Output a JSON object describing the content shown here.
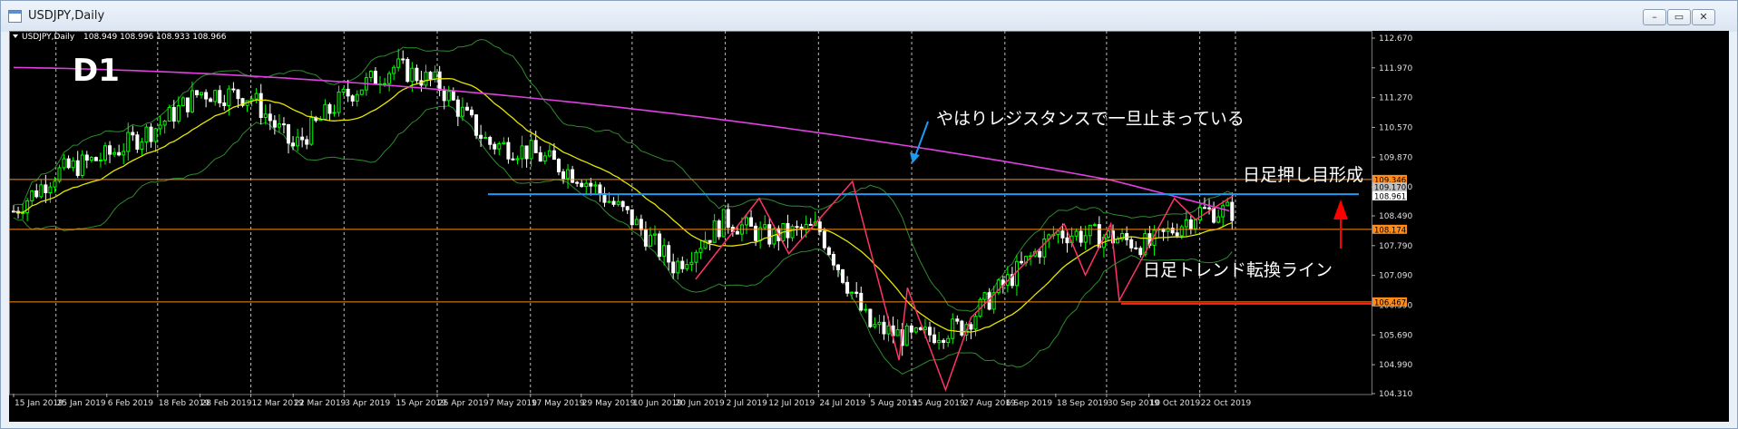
{
  "window": {
    "title": "USDJPY,Daily",
    "buttons": {
      "minimize": "–",
      "restore": "▭",
      "close": "✕"
    }
  },
  "chart_header": {
    "symbol_label": "USDJPY,Daily",
    "ohlc": "108.949 108.996 108.933 108.966"
  },
  "annotations": {
    "timeframe_label": "D1",
    "resistance_note": "やはりレジスタンスで一旦止まっている",
    "pullback_note": "日足押し目形成",
    "trend_line_note": "日足トレンド転換ライン"
  },
  "price_axis_ticks": [
    "112.670",
    "111.970",
    "111.270",
    "110.570",
    "109.870",
    "109.170",
    "108.490",
    "107.790",
    "107.090",
    "106.390",
    "105.690",
    "104.990",
    "104.310"
  ],
  "level_tags": [
    {
      "label": "109.346",
      "color": "#ff8c1a"
    },
    {
      "label": "109.170",
      "color": "#c0c0c0"
    },
    {
      "label": "108.961",
      "color": "#ffffff"
    },
    {
      "label": "108.174",
      "color": "#ff8c1a"
    },
    {
      "label": "106.467",
      "color": "#ff8c1a"
    }
  ],
  "date_ticks": [
    "15 Jan 2019",
    "25 Jan 2019",
    "6 Feb 2019",
    "18 Feb 2019",
    "28 Feb 2019",
    "12 Mar 2019",
    "22 Mar 2019",
    "3 Apr 2019",
    "15 Apr 2019",
    "25 Apr 2019",
    "7 May 2019",
    "17 May 2019",
    "29 May 2019",
    "10 Jun 2019",
    "20 Jun 2019",
    "2 Jul 2019",
    "12 Jul 2019",
    "24 Jul 2019",
    "5 Aug 2019",
    "15 Aug 2019",
    "27 Aug 2019",
    "6 Sep 2019",
    "18 Sep 2019",
    "30 Sep 2019",
    "10 Oct 2019",
    "22 Oct 2019"
  ],
  "colors": {
    "background": "#000000",
    "bull_candle": "#00ff00",
    "bear_candle": "#ffffff",
    "ma_long": "#e040e0",
    "ma_short": "#e6e600",
    "bollinger": "#2e8b2e",
    "horizontal_level": "#ff8c1a",
    "resistance_line": "#1e9bf0",
    "zigzag": "#ff3366",
    "trend_line": "#ff2020",
    "arrow": "#ff0000"
  },
  "chart_data": {
    "type": "candlestick",
    "symbol": "USDJPY",
    "timeframe": "Daily",
    "ylim": [
      104.31,
      112.67
    ],
    "horizontal_levels": [
      109.346,
      108.174,
      106.467
    ],
    "resistance_level": 109.0,
    "trend_line_level": 106.467,
    "zigzag_pivots": [
      {
        "date": "2019-06-25",
        "price": 107.0
      },
      {
        "date": "2019-07-10",
        "price": 108.9
      },
      {
        "date": "2019-07-17",
        "price": 107.6
      },
      {
        "date": "2019-08-01",
        "price": 109.3
      },
      {
        "date": "2019-08-12",
        "price": 105.1
      },
      {
        "date": "2019-08-14",
        "price": 106.8
      },
      {
        "date": "2019-08-23",
        "price": 104.4
      },
      {
        "date": "2019-08-29",
        "price": 106.1
      },
      {
        "date": "2019-09-20",
        "price": 108.3
      },
      {
        "date": "2019-09-25",
        "price": 107.1
      },
      {
        "date": "2019-10-01",
        "price": 108.3
      },
      {
        "date": "2019-10-03",
        "price": 106.5
      },
      {
        "date": "2019-10-16",
        "price": 108.9
      },
      {
        "date": "2019-10-21",
        "price": 108.4
      },
      {
        "date": "2019-10-30",
        "price": 108.97
      }
    ],
    "close_path": [
      {
        "date": "2019-01-15",
        "price": 108.6
      },
      {
        "date": "2019-01-25",
        "price": 109.5
      },
      {
        "date": "2019-02-06",
        "price": 109.9
      },
      {
        "date": "2019-02-18",
        "price": 110.6
      },
      {
        "date": "2019-02-28",
        "price": 111.4
      },
      {
        "date": "2019-03-12",
        "price": 111.3
      },
      {
        "date": "2019-03-22",
        "price": 110.1
      },
      {
        "date": "2019-04-03",
        "price": 111.3
      },
      {
        "date": "2019-04-15",
        "price": 112.0
      },
      {
        "date": "2019-04-25",
        "price": 111.6
      },
      {
        "date": "2019-05-07",
        "price": 110.2
      },
      {
        "date": "2019-05-17",
        "price": 110.0
      },
      {
        "date": "2019-05-29",
        "price": 109.4
      },
      {
        "date": "2019-06-10",
        "price": 108.4
      },
      {
        "date": "2019-06-20",
        "price": 107.3
      },
      {
        "date": "2019-07-02",
        "price": 108.4
      },
      {
        "date": "2019-07-12",
        "price": 108.0
      },
      {
        "date": "2019-07-24",
        "price": 108.2
      },
      {
        "date": "2019-08-05",
        "price": 105.9
      },
      {
        "date": "2019-08-15",
        "price": 105.6
      },
      {
        "date": "2019-08-27",
        "price": 105.9
      },
      {
        "date": "2019-09-06",
        "price": 106.9
      },
      {
        "date": "2019-09-18",
        "price": 108.1
      },
      {
        "date": "2019-09-30",
        "price": 108.0
      },
      {
        "date": "2019-10-10",
        "price": 107.8
      },
      {
        "date": "2019-10-22",
        "price": 108.6
      }
    ]
  }
}
